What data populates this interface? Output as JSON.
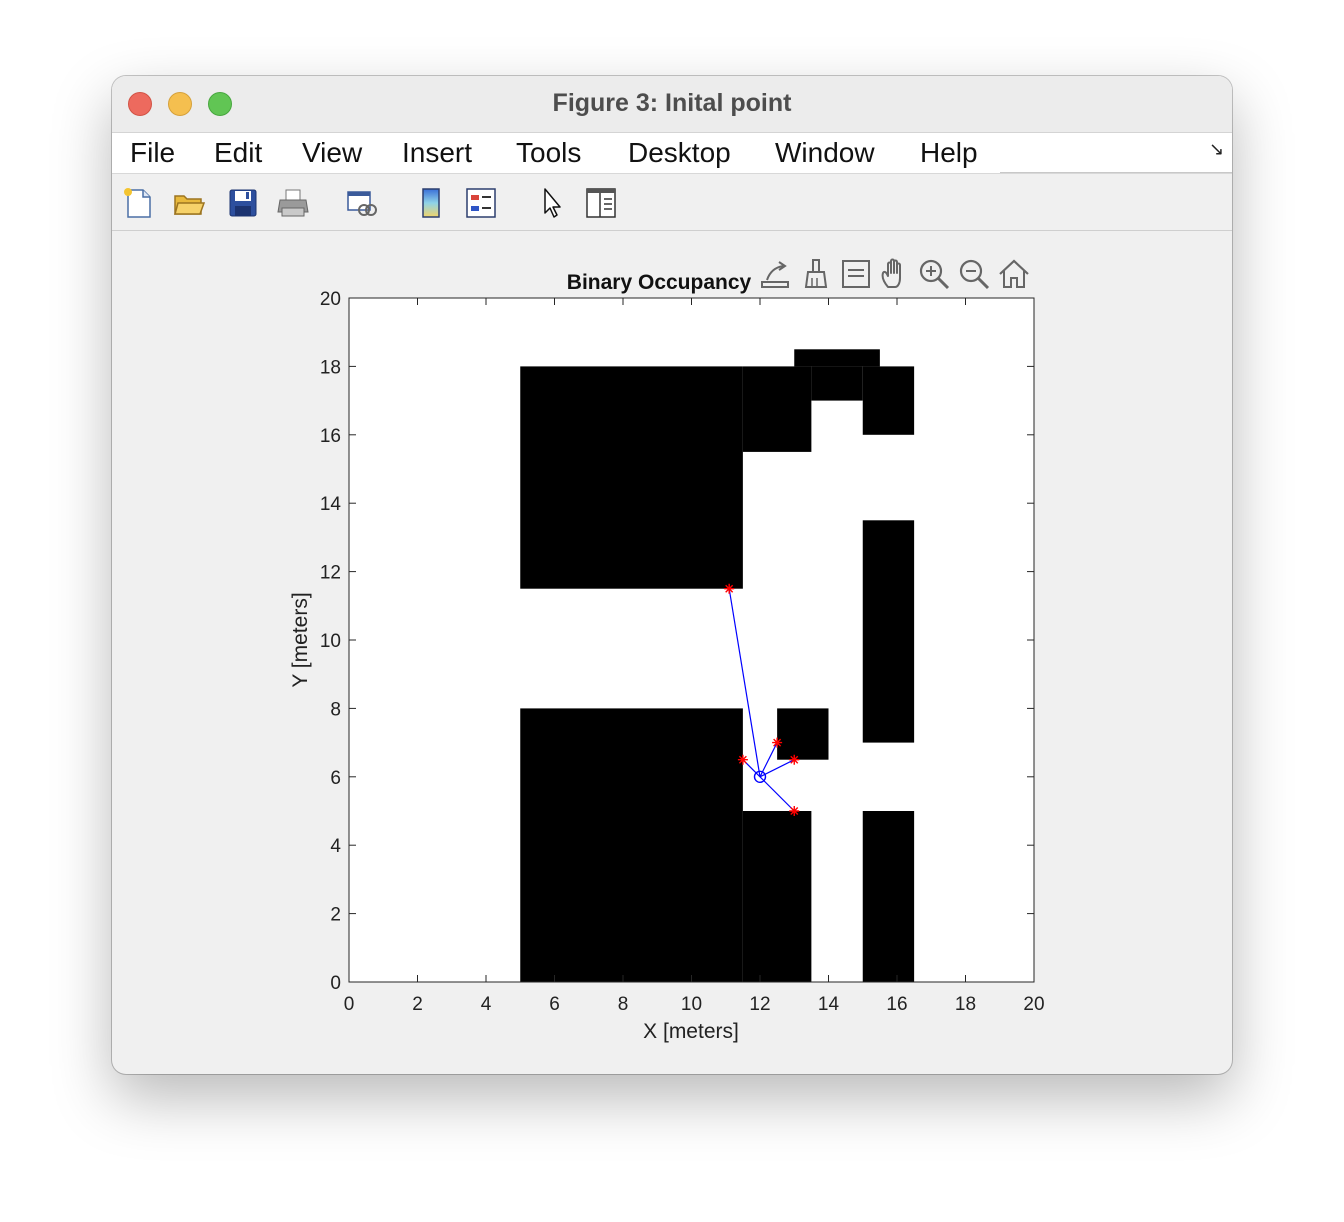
{
  "window": {
    "title": "Figure 3: Inital point"
  },
  "menu": {
    "file": "File",
    "edit": "Edit",
    "view": "View",
    "insert": "Insert",
    "tools": "Tools",
    "desktop": "Desktop",
    "window": "Window",
    "help": "Help"
  },
  "toolbar": {
    "icons": [
      "new-figure-icon",
      "open-file-icon",
      "save-icon",
      "print-icon",
      "link-plot-icon",
      "insert-colorbar-icon",
      "insert-legend-icon",
      "edit-plot-arrow-icon",
      "property-inspector-icon"
    ]
  },
  "axes_toolbar": {
    "icons": [
      "export-icon",
      "brush-icon",
      "data-tips-icon",
      "pan-hand-icon",
      "zoom-in-icon",
      "zoom-out-icon",
      "restore-view-home-icon"
    ]
  },
  "chart_data": {
    "type": "occupancy-map",
    "title": "Binary Occupancy",
    "xlabel": "X [meters]",
    "ylabel": "Y [meters]",
    "xlim": [
      0,
      20
    ],
    "ylim": [
      0,
      20
    ],
    "xticks": [
      "0",
      "2",
      "4",
      "6",
      "8",
      "10",
      "12",
      "14",
      "16",
      "18",
      "20"
    ],
    "yticks": [
      "0",
      "2",
      "4",
      "6",
      "8",
      "10",
      "12",
      "14",
      "16",
      "18",
      "20"
    ],
    "grid": false,
    "occupied_color": "#000000",
    "free_color": "#ffffff",
    "occupied_cells": [
      [
        5,
        11.5,
        11.5,
        18
      ],
      [
        11.5,
        15.5,
        13.5,
        18
      ],
      [
        13.5,
        17,
        15,
        18
      ],
      [
        13,
        18,
        15.5,
        18.5
      ],
      [
        15,
        16,
        16.5,
        18
      ],
      [
        5,
        0,
        11.5,
        8
      ],
      [
        11.5,
        0,
        13.5,
        5
      ],
      [
        12.5,
        6.5,
        14,
        8
      ],
      [
        15,
        7,
        16.5,
        13.5
      ],
      [
        15,
        0,
        16.5,
        5
      ]
    ],
    "robot": {
      "x": 12,
      "y": 6,
      "marker": "circle",
      "color": "#0000ff"
    },
    "ray_endpoints": [
      {
        "x": 11.1,
        "y": 11.5
      },
      {
        "x": 11.5,
        "y": 6.5
      },
      {
        "x": 12.5,
        "y": 7
      },
      {
        "x": 13,
        "y": 6.5
      },
      {
        "x": 13,
        "y": 5
      }
    ],
    "ray_color": "#0000ff",
    "endpoint_marker": "asterisk",
    "endpoint_color": "#ff0000"
  }
}
